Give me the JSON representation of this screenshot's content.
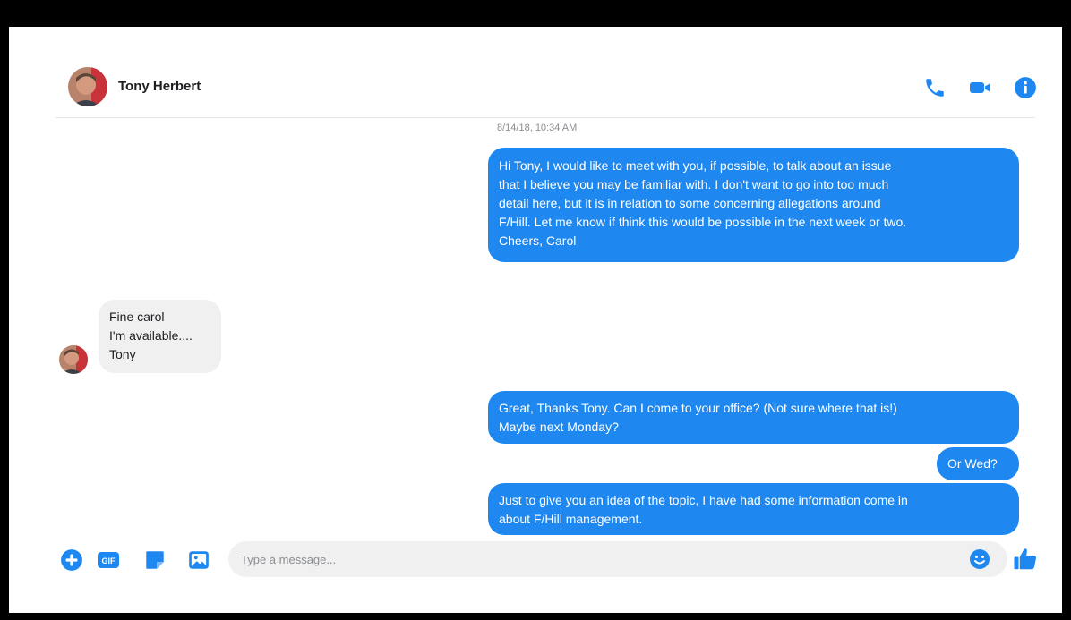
{
  "header": {
    "contact_name": "Tony Herbert",
    "icons": [
      "phone-icon",
      "video-call-icon",
      "info-icon"
    ]
  },
  "conversation": {
    "timestamp": "8/14/18, 10:34 AM",
    "messages": [
      {
        "direction": "outgoing",
        "lines": [
          "Hi Tony, I would like to meet with you, if possible, to talk about an issue",
          "that I believe you may be familiar with. I don't want to go into too much",
          "detail here, but it is in relation to some concerning allegations around",
          "F/Hill. Let me know if think this would be possible in the next week or two.",
          "Cheers, Carol"
        ]
      },
      {
        "direction": "incoming",
        "lines": [
          "Fine carol",
          "I'm available....",
          "Tony"
        ]
      },
      {
        "direction": "outgoing",
        "lines": [
          "Great, Thanks Tony. Can I come to your office? (Not sure where that is!)",
          "Maybe next Monday?"
        ]
      },
      {
        "direction": "outgoing",
        "lines": [
          "Or Wed?"
        ]
      },
      {
        "direction": "outgoing",
        "lines": [
          "Just to give you an idea of the topic, I have had some information come in",
          "about F/Hill management."
        ]
      }
    ]
  },
  "composer": {
    "placeholder": "Type a message...",
    "value": "",
    "gif_label": "GIF",
    "icons": [
      "add-icon",
      "gif-icon",
      "sticker-icon",
      "image-icon",
      "emoji-icon",
      "thumbs-up-icon"
    ]
  },
  "colors": {
    "accent": "#1e88f0",
    "incoming_bubble": "#f0f0f0",
    "timestamp_text": "#8a8d91"
  }
}
